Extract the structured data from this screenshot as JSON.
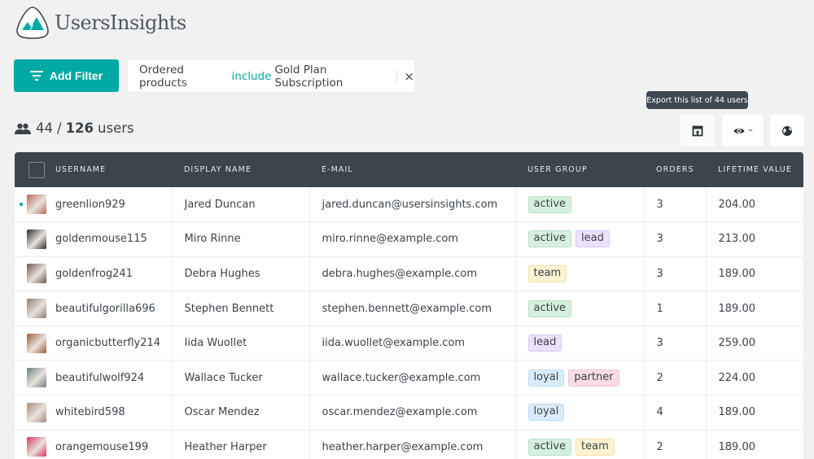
{
  "app": {
    "name": "UsersInsights"
  },
  "toolbar": {
    "add_filter_label": "Add Filter",
    "filter": {
      "field": "Ordered products",
      "operator": "include",
      "value": "Gold Plan Subscription",
      "close": "×"
    },
    "count": {
      "filtered": "44",
      "separator": "/",
      "total": "126",
      "unit": "users"
    },
    "export_tooltip": "Export this list of 44 users",
    "buttons": {
      "export_icon": "export-icon",
      "columns_icon": "eye-icon",
      "map_icon": "globe-icon"
    }
  },
  "colors": {
    "accent": "#00a9a4",
    "header_bg": "#3d444e",
    "badges": {
      "active": {
        "bg": "#d6f0e0",
        "border": "#b7e2c7"
      },
      "lead": {
        "bg": "#ebe1fb",
        "border": "#d8c8f4"
      },
      "team": {
        "bg": "#fdf3d3",
        "border": "#f3e2a8"
      },
      "loyal": {
        "bg": "#d9ecfb",
        "border": "#bcdaf3"
      },
      "partner": {
        "bg": "#fbdde6",
        "border": "#f3c2d1"
      }
    }
  },
  "table": {
    "columns": [
      "Username",
      "Display Name",
      "E-mail",
      "User Group",
      "Orders",
      "Lifetime Value"
    ],
    "rows": [
      {
        "username": "greenlion929",
        "display_name": "Jared Duncan",
        "email": "jared.duncan@usersinsights.com",
        "groups": [
          "active"
        ],
        "orders": "3",
        "lifetime_value": "204.00",
        "online": true,
        "avatar_color": "#b86a5c"
      },
      {
        "username": "goldenmouse115",
        "display_name": "Miro Rinne",
        "email": "miro.rinne@example.com",
        "groups": [
          "active",
          "lead"
        ],
        "orders": "3",
        "lifetime_value": "213.00",
        "online": false,
        "avatar_color": "#2f2a2e"
      },
      {
        "username": "goldenfrog241",
        "display_name": "Debra Hughes",
        "email": "debra.hughes@example.com",
        "groups": [
          "team"
        ],
        "orders": "3",
        "lifetime_value": "189.00",
        "online": false,
        "avatar_color": "#6b5550"
      },
      {
        "username": "beautifulgorilla696",
        "display_name": "Stephen Bennett",
        "email": "stephen.bennett@example.com",
        "groups": [
          "active"
        ],
        "orders": "1",
        "lifetime_value": "189.00",
        "online": false,
        "avatar_color": "#8a7a72"
      },
      {
        "username": "organicbutterfly214",
        "display_name": "Iida Wuollet",
        "email": "iida.wuollet@example.com",
        "groups": [
          "lead"
        ],
        "orders": "3",
        "lifetime_value": "259.00",
        "online": false,
        "avatar_color": "#9a5a3e"
      },
      {
        "username": "beautifulwolf924",
        "display_name": "Wallace Tucker",
        "email": "wallace.tucker@example.com",
        "groups": [
          "loyal",
          "partner"
        ],
        "orders": "2",
        "lifetime_value": "224.00",
        "online": false,
        "avatar_color": "#6f7c86"
      },
      {
        "username": "whitebird598",
        "display_name": "Oscar Mendez",
        "email": "oscar.mendez@example.com",
        "groups": [
          "loyal"
        ],
        "orders": "4",
        "lifetime_value": "189.00",
        "online": false,
        "avatar_color": "#a38a78"
      },
      {
        "username": "orangemouse199",
        "display_name": "Heather Harper",
        "email": "heather.harper@example.com",
        "groups": [
          "active",
          "team"
        ],
        "orders": "2",
        "lifetime_value": "189.00",
        "online": false,
        "avatar_color": "#d8345f"
      }
    ]
  }
}
